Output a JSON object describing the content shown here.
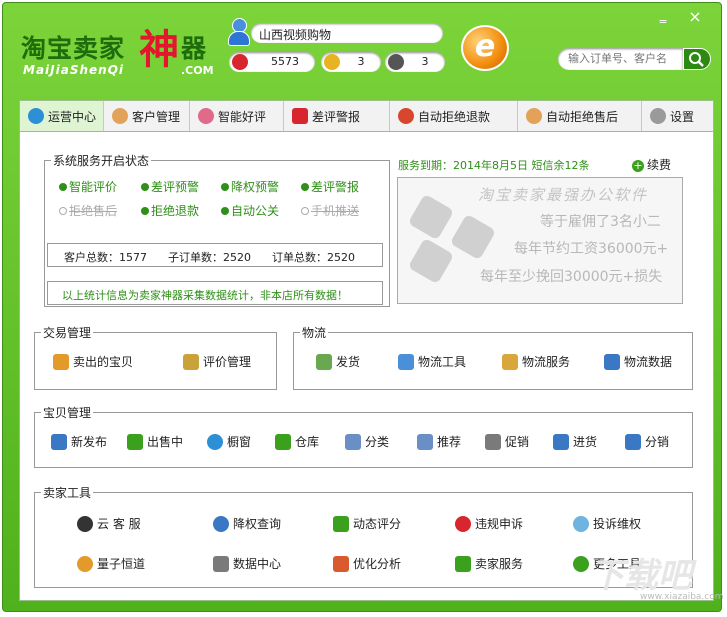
{
  "app": {
    "logo_main": "淘宝卖家",
    "logo_big": "神",
    "logo_tail": "器",
    "logo_sub": "MaiJiaShenQi",
    "logo_com": ".COM",
    "shop_name": "山西视频购物",
    "stats": [
      {
        "icon": "red-flower-icon",
        "value": "5573",
        "color": "#d8262e"
      },
      {
        "icon": "yellow-flower-icon",
        "value": "3",
        "color": "#e8b320"
      },
      {
        "icon": "bomb-icon",
        "value": "3",
        "color": "#555555"
      }
    ],
    "window_controls": {
      "minimize": "‗",
      "close": "×"
    }
  },
  "search": {
    "placeholder": "输入订单号、客户名"
  },
  "tabs": [
    {
      "label": "运营中心",
      "icon": "globe-icon",
      "active": true
    },
    {
      "label": "客户管理",
      "icon": "person-icon"
    },
    {
      "label": "智能好评",
      "icon": "candy-icon"
    },
    {
      "label": "差评警报",
      "icon": "alarm-icon"
    },
    {
      "label": "自动拒绝退款",
      "icon": "refund-icon"
    },
    {
      "label": "自动拒绝售后",
      "icon": "aftersale-icon"
    },
    {
      "label": "设置",
      "icon": "gear-icon"
    }
  ],
  "service": {
    "title": "系统服务开启状态",
    "items": [
      {
        "label": "智能评价",
        "enabled": true
      },
      {
        "label": "差评预警",
        "enabled": true
      },
      {
        "label": "降权预警",
        "enabled": true
      },
      {
        "label": "差评警报",
        "enabled": true
      },
      {
        "label": "拒绝售后",
        "enabled": false
      },
      {
        "label": "拒绝退款",
        "enabled": true
      },
      {
        "label": "自动公关",
        "enabled": true
      },
      {
        "label": "手机推送",
        "enabled": false
      }
    ],
    "totals": {
      "customers": "客户总数：1577",
      "sub_orders": "子订单数：2520",
      "orders": "订单总数：2520"
    },
    "note": "以上统计信息为卖家神器采集数据统计，非本店所有数据！"
  },
  "subscription": {
    "expire": "服务到期：2014年8月5日  短信余12条",
    "renew": "续费"
  },
  "ad": {
    "title": "淘宝卖家最强办公软件",
    "line1": "等于雇佣了3名小二",
    "line2": "每年节约工资36000元+",
    "line3": "每年至少挽回30000元+损失"
  },
  "trade": {
    "title": "交易管理",
    "items": [
      {
        "label": "卖出的宝贝",
        "icon": "sold-items-icon",
        "color": "#e39a2a"
      },
      {
        "label": "评价管理",
        "icon": "rating-icon",
        "color": "#c9a23a"
      }
    ]
  },
  "logistics": {
    "title": "物流",
    "items": [
      {
        "label": "发货",
        "icon": "ship-icon",
        "color": "#6aa84f"
      },
      {
        "label": "物流工具",
        "icon": "logistics-tool-icon",
        "color": "#4a90d9"
      },
      {
        "label": "物流服务",
        "icon": "logistics-service-icon",
        "color": "#d8a63a"
      },
      {
        "label": "物流数据",
        "icon": "logistics-data-icon",
        "color": "#3a78c4"
      }
    ]
  },
  "goods": {
    "title": "宝贝管理",
    "items": [
      {
        "label": "新发布",
        "icon": "new-post-icon",
        "color": "#3a78c4"
      },
      {
        "label": "出售中",
        "icon": "cart-icon",
        "color": "#3aa01e"
      },
      {
        "label": "橱窗",
        "icon": "showcase-icon",
        "color": "#2d8fd6"
      },
      {
        "label": "仓库",
        "icon": "warehouse-icon",
        "color": "#3aa01e"
      },
      {
        "label": "分类",
        "icon": "category-icon",
        "color": "#6a8fc4"
      },
      {
        "label": "推荐",
        "icon": "recommend-icon",
        "color": "#6a8fc4"
      },
      {
        "label": "促销",
        "icon": "promotion-icon",
        "color": "#7a7a7a"
      },
      {
        "label": "进货",
        "icon": "purchase-icon",
        "color": "#3a78c4"
      },
      {
        "label": "分销",
        "icon": "distribution-icon",
        "color": "#3a78c4"
      }
    ]
  },
  "tools": {
    "title": "卖家工具",
    "row1": [
      {
        "label": "云 客 服",
        "icon": "headset-icon",
        "color": "#333333"
      },
      {
        "label": "降权查询",
        "icon": "search-magnifier-icon",
        "color": "#3a78c4"
      },
      {
        "label": "动态评分",
        "icon": "check-icon",
        "color": "#3aa01e"
      },
      {
        "label": "违规申诉",
        "icon": "appeal-icon",
        "color": "#d8262e"
      },
      {
        "label": "投诉维权",
        "icon": "chat-bubble-icon",
        "color": "#6fb3e0"
      }
    ],
    "row2": [
      {
        "label": "量子恒道",
        "icon": "quantum-icon",
        "color": "#e39a2a"
      },
      {
        "label": "数据中心",
        "icon": "data-center-icon",
        "color": "#7a7a7a"
      },
      {
        "label": "优化分析",
        "icon": "bar-chart-icon",
        "color": "#d85a2e"
      },
      {
        "label": "卖家服务",
        "icon": "seller-service-icon",
        "color": "#3aa01e"
      },
      {
        "label": "更多工具",
        "icon": "plus-icon",
        "color": "#3aa01e"
      }
    ]
  },
  "watermark": {
    "main": "下载吧",
    "url": "www.xiazaiba.com"
  }
}
